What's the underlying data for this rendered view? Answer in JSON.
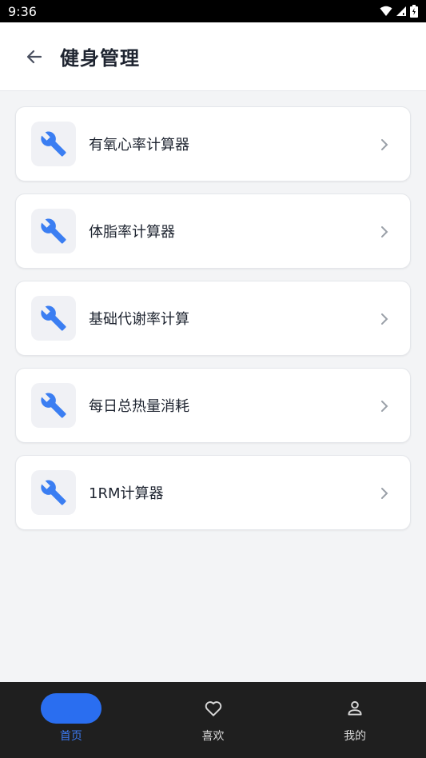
{
  "status_bar": {
    "time": "9:36"
  },
  "header": {
    "title": "健身管理"
  },
  "tools": [
    {
      "label": "有氧心率计算器"
    },
    {
      "label": "体脂率计算器"
    },
    {
      "label": "基础代谢率计算"
    },
    {
      "label": "每日总热量消耗"
    },
    {
      "label": "1RM计算器"
    }
  ],
  "bottom_nav": [
    {
      "label": "首页",
      "active": true
    },
    {
      "label": "喜欢",
      "active": false
    },
    {
      "label": "我的",
      "active": false
    }
  ],
  "colors": {
    "accent": "#2a6ef0",
    "icon": "#3b7ef2"
  }
}
